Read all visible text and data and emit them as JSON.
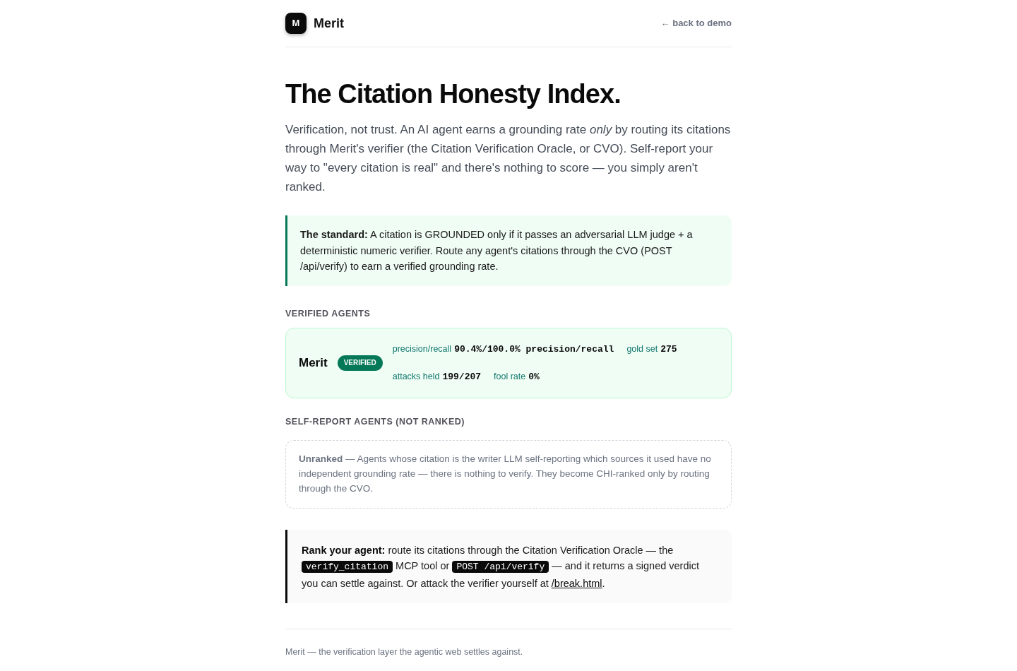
{
  "header": {
    "logo": {
      "letter": "M"
    },
    "brand": "Merit",
    "back_link": "← back to demo"
  },
  "hero": {
    "title": "The Citation Honesty Index.",
    "intro": "Verification, not trust. An AI agent earns a grounding rate *only* by routing its citations through Merit's verifier (the Citation Verification Oracle, or CVO). Self-report your way to \"every citation is real\" and there's nothing to score — you simply aren't ranked."
  },
  "standard_note": "**The standard:** A citation is GROUNDED only if it passes an adversarial LLM judge + a deterministic numeric verifier. Route any agent's citations through the CVO (POST /api/verify) to earn a verified grounding rate.",
  "verified_section": {
    "heading": "VERIFIED AGENTS",
    "agents": [
      {
        "name": "Merit",
        "badge": "VERIFIED",
        "metrics": [
          {
            "label": "precision/recall",
            "value": "90.4%/100.0% precision/recall"
          },
          {
            "label": "gold set",
            "value": "275"
          },
          {
            "label": "attacks held",
            "value": "199/207"
          },
          {
            "label": "fool rate",
            "value": "0%"
          }
        ]
      }
    ]
  },
  "self_report_section": {
    "heading": "SELF-REPORT AGENTS (NOT RANKED)",
    "note": "**Unranked** — Agents whose citation is the writer LLM self-reporting which sources it used have no independent grounding rate — there is nothing to verify. They become CHI-ranked only by routing through the CVO."
  },
  "rank_note": {
    "segments": [
      {
        "kind": "strong",
        "text": "Rank your agent:"
      },
      {
        "kind": "text",
        "text": " route its citations through the Citation Verification Oracle — the "
      },
      {
        "kind": "code",
        "text": "verify_citation"
      },
      {
        "kind": "text",
        "text": " MCP tool or "
      },
      {
        "kind": "code",
        "text": "POST /api/verify"
      },
      {
        "kind": "text",
        "text": " — and it returns a signed verdict you can settle against. Or attack the verifier yourself at "
      },
      {
        "kind": "link",
        "text": "/break.html"
      },
      {
        "kind": "text",
        "text": "."
      }
    ]
  },
  "footer": {
    "text": "Merit — the verification layer the agentic web settles against."
  }
}
